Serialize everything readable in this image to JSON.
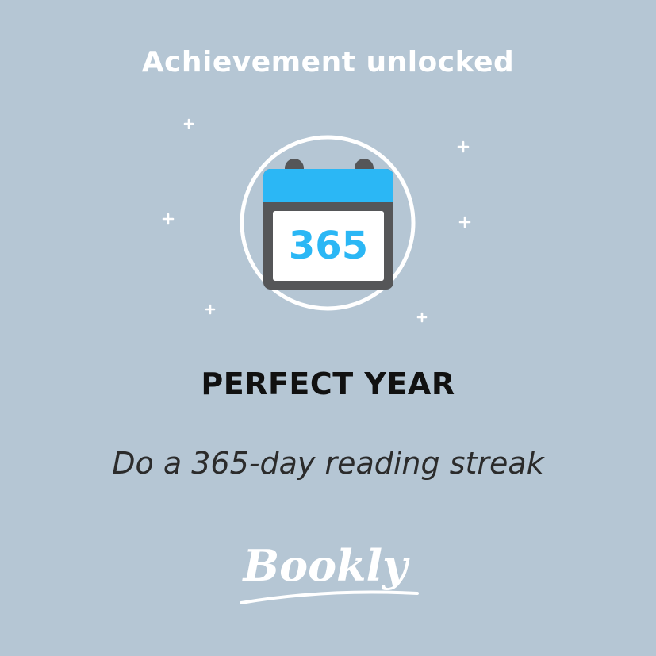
{
  "header": {
    "text": "Achievement unlocked"
  },
  "badge": {
    "number": "365",
    "icon": "calendar-icon",
    "colors": {
      "calendar_top": "#2bb7f5",
      "calendar_frame": "#555658",
      "circle": "#ffffff",
      "number": "#2bb7f5",
      "sparkle": "#ffffff"
    }
  },
  "achievement": {
    "title": "PERFECT YEAR",
    "description": "Do a 365-day reading streak"
  },
  "brand": {
    "name": "Bookly"
  },
  "colors": {
    "background": "#b5c6d4",
    "header_text": "#ffffff",
    "title_text": "#111111",
    "description_text": "#2b2b2b"
  }
}
